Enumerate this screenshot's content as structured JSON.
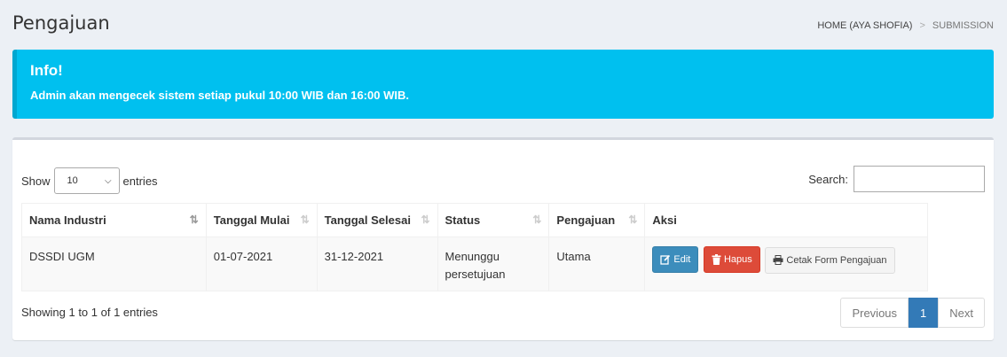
{
  "header": {
    "title": "Pengajuan",
    "breadcrumb": [
      "HOME (AYA SHOFIA)",
      "SUBMISSION"
    ]
  },
  "callout": {
    "title": "Info!",
    "text": "Admin akan mengecek sistem setiap pukul 10:00 WIB dan 16:00 WIB."
  },
  "table_controls": {
    "show_label": "Show",
    "entries_value": "10",
    "entries_label": "entries",
    "search_label": "Search:"
  },
  "table": {
    "columns": [
      "Nama Industri",
      "Tanggal Mulai",
      "Tanggal Selesai",
      "Status",
      "Pengajuan",
      "Aksi"
    ],
    "rows": [
      {
        "nama_industri": "DSSDI UGM",
        "tanggal_mulai": "01-07-2021",
        "tanggal_selesai": "31-12-2021",
        "status": "Menunggu persetujuan",
        "pengajuan": "Utama",
        "actions": {
          "edit": "Edit",
          "hapus": "Hapus",
          "cetak": "Cetak Form Pengajuan"
        }
      }
    ]
  },
  "footer": {
    "info": "Showing 1 to 1 of 1 entries",
    "pagination": {
      "previous": "Previous",
      "current": "1",
      "next": "Next"
    }
  },
  "colors": {
    "callout": "#00c0ef",
    "edit": "#3c8dbc",
    "hapus": "#dd4b39",
    "active_page": "#337ab7"
  }
}
